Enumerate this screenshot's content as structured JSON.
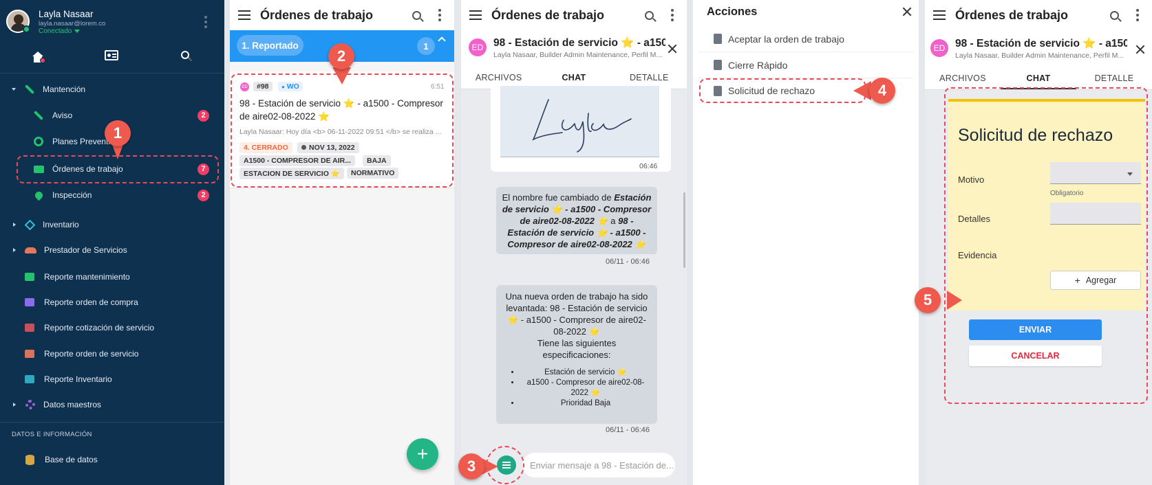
{
  "sidebar": {
    "user_name": "Layla Nasaar",
    "user_email": "layla.nasaar@lorem.co",
    "status": "Conectado",
    "items": [
      {
        "label": "Mantención"
      },
      {
        "label": "Aviso",
        "badge": "2"
      },
      {
        "label": "Planes Preventivos"
      },
      {
        "label": "Órdenes de trabajo",
        "badge": "7"
      },
      {
        "label": "Inspección",
        "badge": "2"
      },
      {
        "label": "Inventario"
      },
      {
        "label": "Prestador de Servicios"
      },
      {
        "label": "Reporte mantenimiento"
      },
      {
        "label": "Reporte orden de compra"
      },
      {
        "label": "Reporte cotización de servicio"
      },
      {
        "label": "Reporte orden de servicio"
      },
      {
        "label": "Reporte Inventario"
      },
      {
        "label": "Datos maestros"
      }
    ],
    "section_label": "DATOS E INFORMACIÓN",
    "db_label": "Base de datos",
    "colors": {
      "bg": "#0f3150",
      "accent": "#23b37a"
    }
  },
  "list": {
    "title": "Órdenes de trabajo",
    "group_label": "1. Reportado",
    "group_count": "1",
    "card": {
      "avatar": "ED",
      "id": "#98",
      "type": "WO",
      "time": "6:51",
      "title": "98 - Estación de servicio ⭐ - a1500 - Compresor de aire02-08-2022 ⭐",
      "preview": "Layla Nasaar: Hoy día <b> 06-11-2022 09:51 </b> se realiza ...",
      "status": "4. CERRADO",
      "date": "NOV 13, 2022",
      "chips": [
        "A1500 - COMPRESOR DE AIR...",
        "BAJA",
        "ESTACION DE SERVICIO ⭐",
        "NORMATIVO"
      ]
    },
    "fab": "+"
  },
  "chat": {
    "title": "Órdenes de trabajo",
    "wo_title": "98 - Estación de servicio ⭐ - a150...",
    "wo_sub": "Layla Nasaar, Builder Admin Maintenance, Perfil M...",
    "avatar": "ED",
    "tabs": [
      "ARCHIVOS",
      "CHAT",
      "DETALLE"
    ],
    "signature_time": "06:46",
    "msg1_parts": [
      "El nombre fue cambiado de ",
      "Estación de servicio ⭐ - a1500 - Compresor de aire02-08-2022 ⭐",
      " a ",
      "98 - Estación de servicio ⭐ - a1500 - Compresor de aire02-08-2022 ⭐"
    ],
    "msg1_time": "06/11 - 06:46",
    "msg2_text": "Una nueva orden de trabajo ha sido levantada: 98 - Estación de servicio ⭐ - a1500 - Compresor de aire02-08-2022 ⭐",
    "msg2_sub": "Tiene las siguientes especificaciones:",
    "msg2_list": [
      "Estación de servicio ⭐",
      "a1500 - Compresor de aire02-08-2022 ⭐",
      "Prioridad Baja"
    ],
    "msg2_time": "06/11 - 06:46",
    "input_placeholder": "Enviar mensaje a 98 - Estación de..."
  },
  "actions": {
    "title": "Acciones",
    "items": [
      "Aceptar la orden de trabajo",
      "Cierre Rápido",
      "Solicitud de rechazo"
    ]
  },
  "reject": {
    "title": "Órdenes de trabajo",
    "wo_title": "98 - Estación de servicio ⭐ - a150...",
    "wo_sub": "Layla Nasaar, Builder Admin Maintenance, Perfil M...",
    "avatar": "ED",
    "tabs": [
      "ARCHIVOS",
      "CHAT",
      "DETALLE"
    ],
    "form_title": "Solicitud de rechazo",
    "motivo_label": "Motivo",
    "motivo_help": "Obligatorio",
    "detalles_label": "Detalles",
    "evidencia_label": "Evidencia",
    "add_label": "Agregar",
    "send_label": "ENVIAR",
    "cancel_label": "CANCELAR"
  },
  "callouts": [
    "1",
    "2",
    "3",
    "4",
    "5"
  ]
}
